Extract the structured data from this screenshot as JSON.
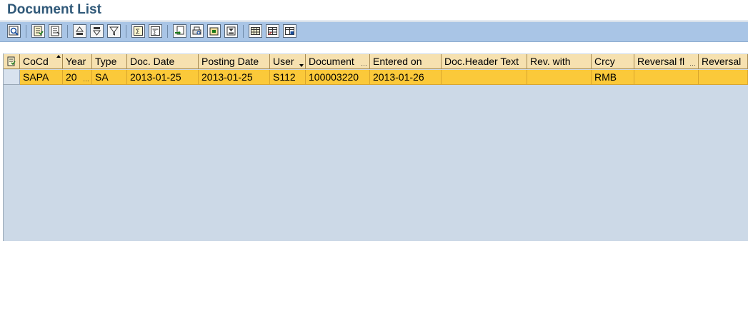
{
  "window": {
    "title": "Document List"
  },
  "toolbar": {
    "buttons": [
      {
        "name": "details-button",
        "icon": "magnifier-detail-icon"
      },
      {
        "name": "select-all-button",
        "icon": "select-all-icon"
      },
      {
        "name": "deselect-all-button",
        "icon": "deselect-all-icon"
      },
      {
        "name": "sort-ascending-button",
        "icon": "sort-ascending-icon"
      },
      {
        "name": "sort-descending-button",
        "icon": "sort-descending-icon"
      },
      {
        "name": "filter-button",
        "icon": "filter-icon"
      },
      {
        "name": "total-button",
        "icon": "total-icon"
      },
      {
        "name": "subtotal-button",
        "icon": "subtotal-icon"
      },
      {
        "name": "export-button",
        "icon": "export-icon"
      },
      {
        "name": "print-preview-button",
        "icon": "print-preview-icon"
      },
      {
        "name": "local-file-button",
        "icon": "local-file-icon"
      },
      {
        "name": "abc-analysis-button",
        "icon": "abc-analysis-icon"
      },
      {
        "name": "change-layout-button",
        "icon": "change-layout-icon"
      },
      {
        "name": "select-layout-button",
        "icon": "select-layout-icon"
      },
      {
        "name": "save-layout-button",
        "icon": "save-layout-icon"
      }
    ]
  },
  "grid": {
    "columns": [
      {
        "label": "CoCd",
        "truncated": false
      },
      {
        "label": "Year",
        "truncated": false
      },
      {
        "label": "Type",
        "truncated": false
      },
      {
        "label": "Doc. Date",
        "truncated": false
      },
      {
        "label": "Posting Date",
        "truncated": false
      },
      {
        "label": "User",
        "truncated": false
      },
      {
        "label": "Document",
        "truncated": true
      },
      {
        "label": "Entered on",
        "truncated": false
      },
      {
        "label": "Doc.Header Text",
        "truncated": false
      },
      {
        "label": "Rev. with",
        "truncated": false
      },
      {
        "label": "Crcy",
        "truncated": false
      },
      {
        "label": "Reversal fl",
        "truncated": true
      },
      {
        "label": "Reversal",
        "truncated": false
      }
    ],
    "rows": [
      {
        "selected": true,
        "cells": [
          "SAPA",
          "20",
          "SA",
          "2013-01-25",
          "2013-01-25",
          "S112",
          "100003220",
          "2013-01-26",
          "",
          "",
          "RMB",
          "",
          ""
        ],
        "truncated": [
          false,
          true,
          false,
          false,
          false,
          false,
          false,
          false,
          false,
          false,
          false,
          false,
          false
        ]
      }
    ],
    "colors": {
      "header_bg": "#f6e1b0",
      "selected_row_bg": "#fbc93a",
      "empty_area_bg": "#ccd9e7",
      "toolbar_bg": "#a9c5e6",
      "title_color": "#2f5878"
    }
  }
}
